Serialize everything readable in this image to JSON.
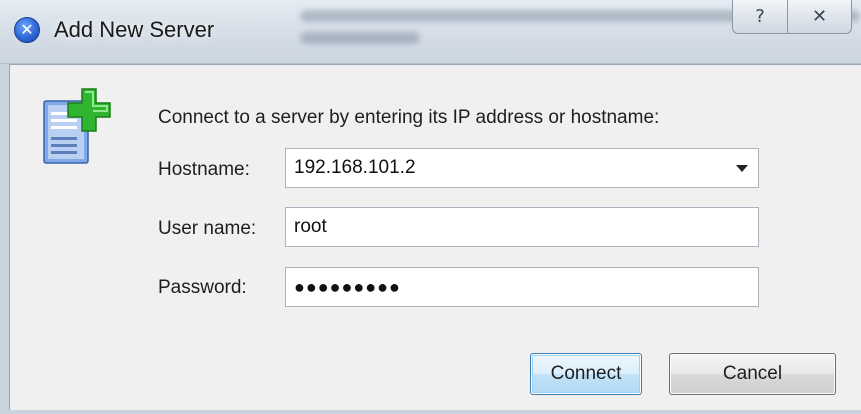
{
  "window": {
    "title": "Add New Server",
    "help_glyph": "?",
    "close_glyph": "✕",
    "app_icon_glyph": "✕"
  },
  "icons": {
    "app": "close-circle-icon",
    "server": "server-add-icon",
    "dropdown": "chevron-down-icon"
  },
  "form": {
    "prompt": "Connect to a server by entering its IP address or hostname:",
    "hostname_label": "Hostname:",
    "hostname_value": "192.168.101.2",
    "username_label": "User name:",
    "username_value": "root",
    "password_label": "Password:",
    "password_masked": "●●●●●●●●●"
  },
  "buttons": {
    "connect": "Connect",
    "cancel": "Cancel"
  },
  "colors": {
    "accent_green": "#2fb52f",
    "icon_blue": "#5a8fd6",
    "default_button_border": "#3c7fb1"
  }
}
